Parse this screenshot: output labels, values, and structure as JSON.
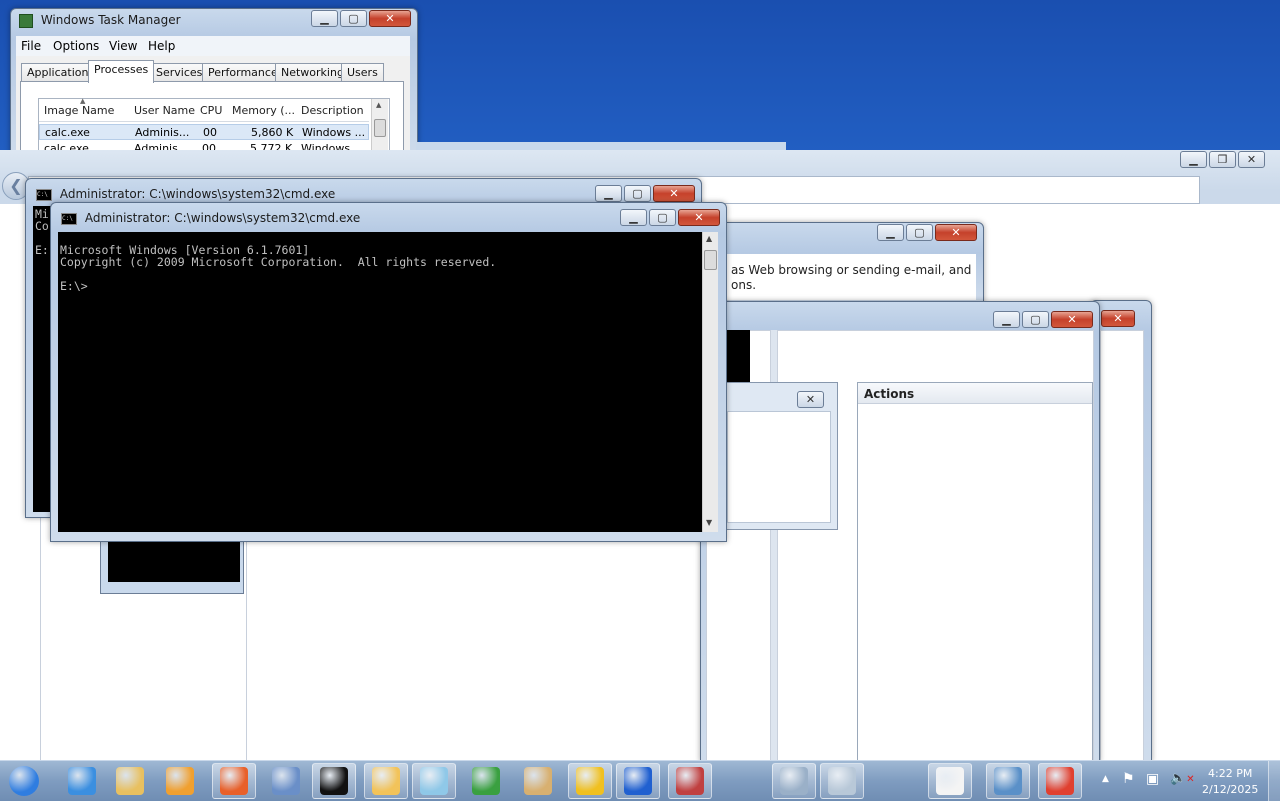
{
  "task_manager": {
    "title": "Windows Task Manager",
    "menu": [
      "File",
      "Options",
      "View",
      "Help"
    ],
    "tabs": [
      "Applications",
      "Processes",
      "Services",
      "Performance",
      "Networking",
      "Users"
    ],
    "active_tab": "Processes",
    "columns": [
      "Image Name",
      "User Name",
      "CPU",
      "Memory (...",
      "Description"
    ],
    "rows": [
      {
        "image": "calc.exe",
        "user": "Adminis...",
        "cpu": "00",
        "memory": "5,860 K",
        "desc": "Windows ..."
      },
      {
        "image": "calc.exe",
        "user": "Adminis...",
        "cpu": "00",
        "memory": "5,772 K",
        "desc": "Windows ..."
      }
    ]
  },
  "cmd_back": {
    "title": "Administrator: C:\\windows\\system32\\cmd.exe",
    "text": "Mi\nCo\n\nE:"
  },
  "cmd_front": {
    "title": "Administrator: C:\\windows\\system32\\cmd.exe",
    "lines": [
      "Microsoft Windows [Version 6.1.7601]",
      "Copyright (c) 2009 Microsoft Corporation.  All rights reserved.",
      "",
      "E:\\>"
    ]
  },
  "ie_window": {
    "text_line1": "as Web browsing or sending e-mail, and",
    "text_line2": "ons."
  },
  "mmc_window": {
    "actions_header": "Actions"
  },
  "taskbar": {
    "clock_time": "4:22 PM",
    "clock_date": "2/12/2025",
    "items": [
      {
        "name": "start-button",
        "color": "#2f7de0"
      },
      {
        "name": "internet-explorer-icon",
        "color": "#3b8fe0"
      },
      {
        "name": "windows-explorer-icon",
        "color": "#e8c060"
      },
      {
        "name": "media-player-icon",
        "color": "#f0a030"
      },
      {
        "name": "firefox-icon",
        "color": "#e8602a"
      },
      {
        "name": "network-search-icon",
        "color": "#6a8fc8"
      },
      {
        "name": "cmd-icon",
        "color": "#111111"
      },
      {
        "name": "calendar-tool-icon",
        "color": "#f2c35a"
      },
      {
        "name": "notepad-tool-icon",
        "color": "#8fc8e8"
      },
      {
        "name": "windows-logo-icon",
        "color": "#3aa040"
      },
      {
        "name": "paint-icon",
        "color": "#d8b070"
      },
      {
        "name": "hand-tool-icon",
        "color": "#f0c020"
      },
      {
        "name": "x-app-icon",
        "color": "#2060d0"
      },
      {
        "name": "record-tool-icon",
        "color": "#c04040"
      },
      {
        "name": "window-app-icon",
        "color": "#9ab0c8"
      },
      {
        "name": "calculator-icon",
        "color": "#b8c8d8"
      },
      {
        "name": "blank-document-icon",
        "color": "#f4f4f4"
      },
      {
        "name": "control-panel-icon",
        "color": "#5a90c8"
      },
      {
        "name": "chrome-icon",
        "color": "#e04030"
      }
    ]
  }
}
